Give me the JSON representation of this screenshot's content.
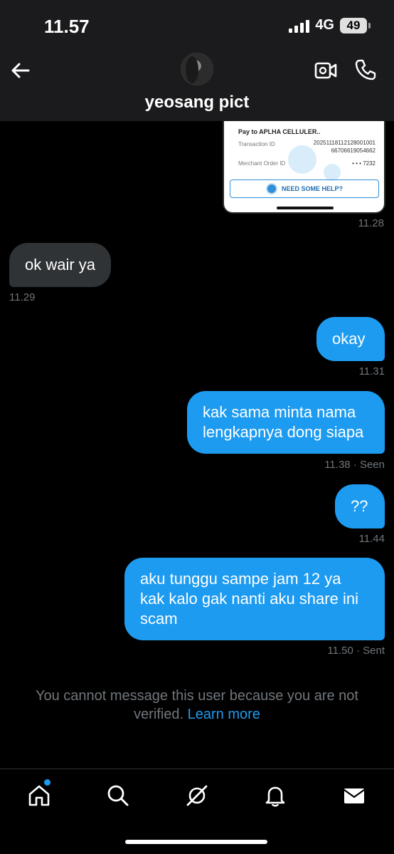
{
  "status_bar": {
    "time": "11.57",
    "network": "4G",
    "battery": "49"
  },
  "header": {
    "name": "yeosang pict"
  },
  "shared_image": {
    "pay_to": "Pay to APLHA CELLULER..",
    "transaction_label": "Transaction ID",
    "transaction_value_1": "2025111811212800100​1",
    "transaction_value_2": "66706619054662",
    "merchant_label": "Merchant Order ID",
    "merchant_value": "• • • 7232",
    "help_label": "NEED SOME HELP?"
  },
  "messages": [
    {
      "text": "",
      "time": "11.28"
    },
    {
      "text": "ok wair ya",
      "time": "11.29"
    },
    {
      "text": "okay",
      "time": "11.31"
    },
    {
      "text": "kak sama minta nama lengkapnya dong siapa",
      "time": "11.38 · Seen"
    },
    {
      "text": "??",
      "time": "11.44"
    },
    {
      "text": "aku tunggu sampe jam 12 ya kak kalo gak nanti aku share ini scam",
      "time": "11.50 · Sent"
    }
  ],
  "notice": {
    "text": "You cannot message this user because you are not verified.",
    "link": "Learn more"
  },
  "colors": {
    "accent": "#1d9bf0",
    "incoming": "#2f3336",
    "background": "#000000"
  },
  "nav": [
    "home-icon",
    "search-icon",
    "grok-icon",
    "notifications-icon",
    "messages-icon"
  ]
}
